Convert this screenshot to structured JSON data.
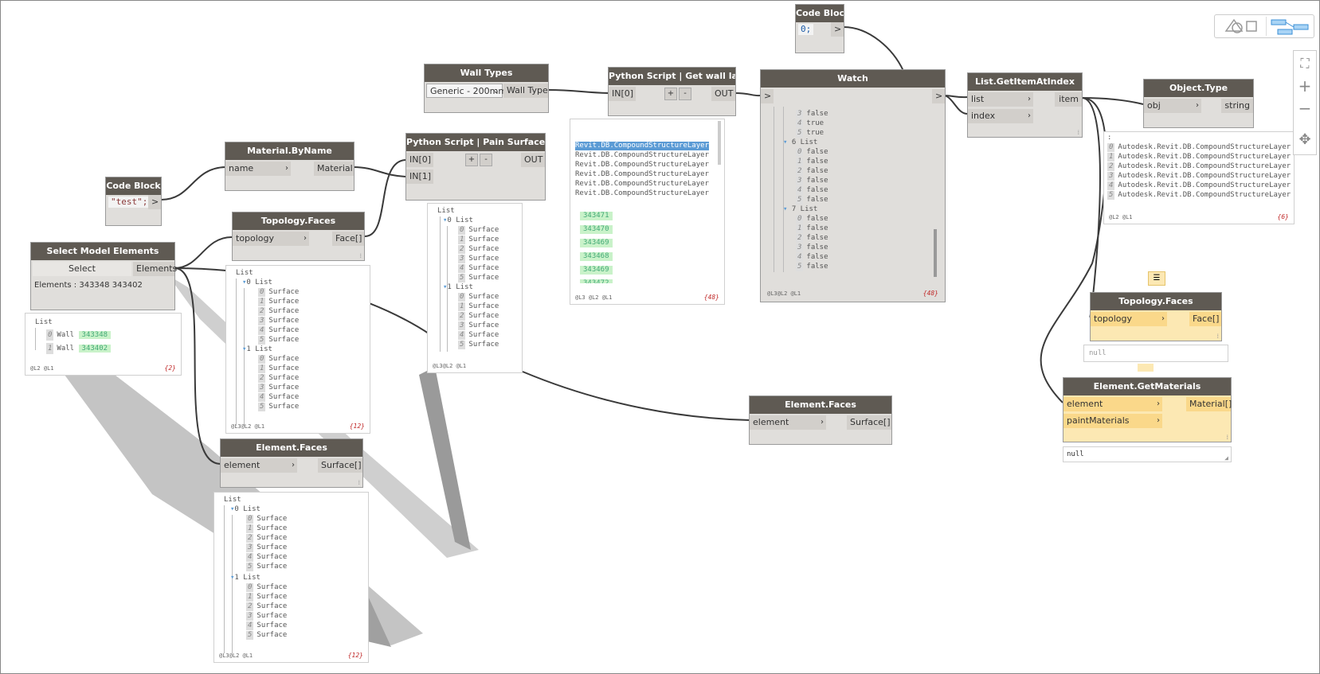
{
  "colors": {
    "node_header": "#5f5a53",
    "node_body": "#e0dedb",
    "port": "#d2cfcb",
    "selected_node": "#fce8b3",
    "wire": "#3a3a3a",
    "green_value": "#c9f2c9",
    "count": "#c02828"
  },
  "nodes": {
    "code_block_top": {
      "title": "Code Block",
      "code": "0;",
      "out": ">"
    },
    "wall_types": {
      "title": "Wall Types",
      "value": "Generic - 200mm",
      "out": "Wall Type"
    },
    "python_wall_layers": {
      "title": "Python Script | Get wall layers",
      "in0": "IN[0]",
      "plus": "+",
      "minus": "-",
      "out": "OUT"
    },
    "watch": {
      "title": "Watch",
      "in": ">",
      "out": ">"
    },
    "list_getitem": {
      "title": "List.GetItemAtIndex",
      "in_list": "list",
      "in_index": "index",
      "out": "item"
    },
    "object_type": {
      "title": "Object.Type",
      "in": "obj",
      "out": "string"
    },
    "material_byname": {
      "title": "Material.ByName",
      "in": "name",
      "out": "Material"
    },
    "python_paint": {
      "title": "Python Script | Pain Surface/Face",
      "in0": "IN[0]",
      "in1": "IN[1]",
      "plus": "+",
      "minus": "-",
      "out": "OUT"
    },
    "code_block_test": {
      "title": "Code Block",
      "code": "\"test\";",
      "out": ">"
    },
    "topology_faces_1": {
      "title": "Topology.Faces",
      "in": "topology",
      "out": "Face[]"
    },
    "select_model": {
      "title": "Select Model Elements",
      "button": "Select",
      "out": "Elements",
      "info": "Elements : 343348 343402"
    },
    "element_faces_1": {
      "title": "Element.Faces",
      "in": "element",
      "out": "Surface[]"
    },
    "element_faces_2": {
      "title": "Element.Faces",
      "in": "element",
      "out": "Surface[]"
    },
    "topology_faces_2": {
      "title": "Topology.Faces",
      "in": "topology",
      "out": "Face[]"
    },
    "element_getmaterials": {
      "title": "Element.GetMaterials",
      "in_element": "element",
      "in_paint": "paintMaterials",
      "out": "Material[]"
    }
  },
  "previews": {
    "select_model": {
      "head": "List",
      "rows": [
        [
          "0",
          "Wall",
          "343348"
        ],
        [
          "1",
          "Wall",
          "343402"
        ]
      ],
      "levels": "@L2 @L1",
      "count": "{2}"
    },
    "topology_faces_1": {
      "head": "List",
      "sub0": "0 List",
      "sub1": "1 List",
      "items": [
        "Surface",
        "Surface",
        "Surface",
        "Surface",
        "Surface",
        "Surface"
      ],
      "idx": [
        "0",
        "1",
        "2",
        "3",
        "4",
        "5"
      ],
      "levels": "@L3@L2 @L1",
      "count": "{12}"
    },
    "python_paint": {
      "head": "List",
      "sub0": "0 List",
      "sub1": "1 List",
      "items": [
        "Surface",
        "Surface",
        "Surface",
        "Surface",
        "Surface",
        "Surface"
      ],
      "idx": [
        "0",
        "1",
        "2",
        "3",
        "4",
        "5"
      ],
      "levels": "@L3@L2 @L1"
    },
    "element_faces_1": {
      "head": "List",
      "sub0": "0 List",
      "sub1": "1 List",
      "items": [
        "Surface",
        "Surface",
        "Surface",
        "Surface",
        "Surface",
        "Surface"
      ],
      "idx": [
        "0",
        "1",
        "2",
        "3",
        "4",
        "5"
      ],
      "levels": "@L3@L2 @L1",
      "count": "{12}"
    },
    "python_wall_layers": {
      "layers": [
        "Revit.DB.CompoundStructureLayer",
        "Revit.DB.CompoundStructureLayer",
        "Revit.DB.CompoundStructureLayer",
        "Revit.DB.CompoundStructureLayer",
        "Revit.DB.CompoundStructureLayer",
        "Revit.DB.CompoundStructureLayer"
      ],
      "ids": [
        "343471",
        "343470",
        "343469",
        "343468",
        "343469",
        "343472"
      ],
      "levels": "@L3 @L2 @L1",
      "count": "{48}"
    },
    "watch": {
      "rows": [
        [
          "3",
          "false"
        ],
        [
          "4",
          "true"
        ],
        [
          "5",
          "true"
        ]
      ],
      "list6": "6 List",
      "list6_rows": [
        [
          "0",
          "false"
        ],
        [
          "1",
          "false"
        ],
        [
          "2",
          "false"
        ],
        [
          "3",
          "false"
        ],
        [
          "4",
          "false"
        ],
        [
          "5",
          "false"
        ]
      ],
      "list7": "7 List",
      "list7_rows": [
        [
          "0",
          "false"
        ],
        [
          "1",
          "false"
        ],
        [
          "2",
          "false"
        ],
        [
          "3",
          "false"
        ],
        [
          "4",
          "false"
        ],
        [
          "5",
          "false"
        ]
      ],
      "levels": "@L3@L2 @L1",
      "count": "{48}"
    },
    "object_type": {
      "head": ":",
      "rows": [
        [
          "0",
          "Autodesk.Revit.DB.CompoundStructureLayer"
        ],
        [
          "1",
          "Autodesk.Revit.DB.CompoundStructureLayer"
        ],
        [
          "2",
          "Autodesk.Revit.DB.CompoundStructureLayer"
        ],
        [
          "3",
          "Autodesk.Revit.DB.CompoundStructureLayer"
        ],
        [
          "4",
          "Autodesk.Revit.DB.CompoundStructureLayer"
        ],
        [
          "5",
          "Autodesk.Revit.DB.CompoundStructureLayer"
        ]
      ],
      "levels": "@L2 @L1",
      "count": "{6}"
    },
    "topology_faces_2": {
      "value": "null"
    },
    "element_getmaterials": {
      "value": "null"
    }
  },
  "toolbar": {
    "icons": [
      "geometry-view-icon",
      "graph-view-icon"
    ]
  },
  "zoom_controls": {
    "icons": [
      "zoom-fit-icon",
      "zoom-in-icon",
      "zoom-out-icon",
      "pan-icon"
    ]
  }
}
